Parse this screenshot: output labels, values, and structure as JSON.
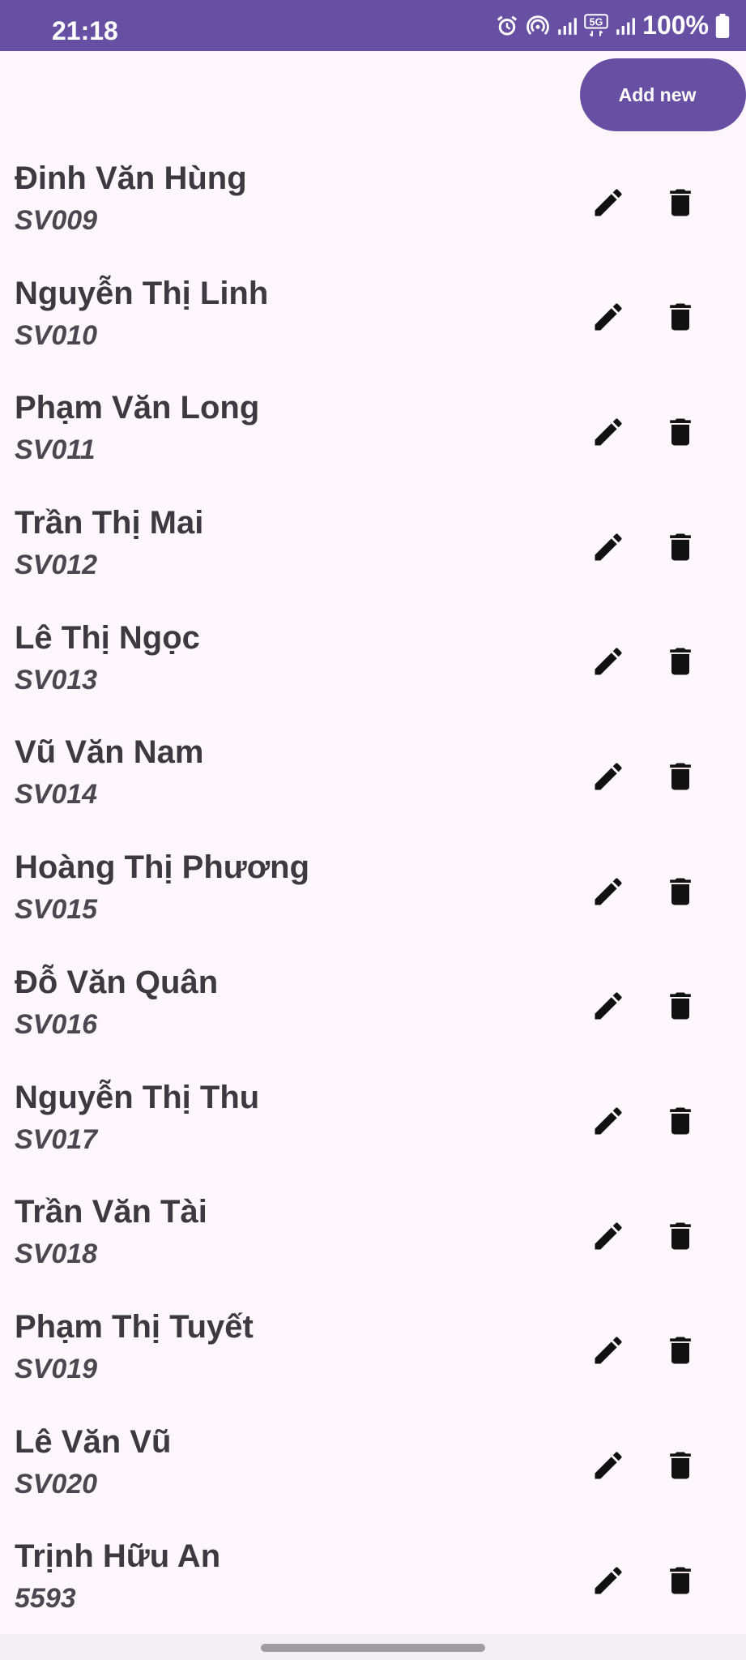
{
  "status_bar": {
    "time": "21:18",
    "battery": "100%",
    "network": "5G",
    "icons": [
      "alarm-icon",
      "hotspot-icon",
      "signal-icon",
      "5g-icon",
      "signal-icon",
      "battery-icon"
    ],
    "color": "#6750a4"
  },
  "actions": {
    "add_label": "Add new"
  },
  "students": [
    {
      "name": "Đinh Văn Hùng",
      "id": "SV009"
    },
    {
      "name": "Nguyễn Thị Linh",
      "id": "SV010"
    },
    {
      "name": "Phạm Văn Long",
      "id": "SV011"
    },
    {
      "name": "Trần Thị Mai",
      "id": "SV012"
    },
    {
      "name": "Lê Thị Ngọc",
      "id": "SV013"
    },
    {
      "name": "Vũ Văn Nam",
      "id": "SV014"
    },
    {
      "name": "Hoàng Thị Phương",
      "id": "SV015"
    },
    {
      "name": "Đỗ Văn Quân",
      "id": "SV016"
    },
    {
      "name": "Nguyễn Thị Thu",
      "id": "SV017"
    },
    {
      "name": "Trần Văn Tài",
      "id": "SV018"
    },
    {
      "name": "Phạm Thị Tuyết",
      "id": "SV019"
    },
    {
      "name": "Lê Văn Vũ",
      "id": "SV020"
    },
    {
      "name": "Trịnh Hữu An",
      "id": "5593"
    }
  ],
  "row_icons": {
    "edit": "pencil-icon",
    "delete": "trash-icon"
  }
}
